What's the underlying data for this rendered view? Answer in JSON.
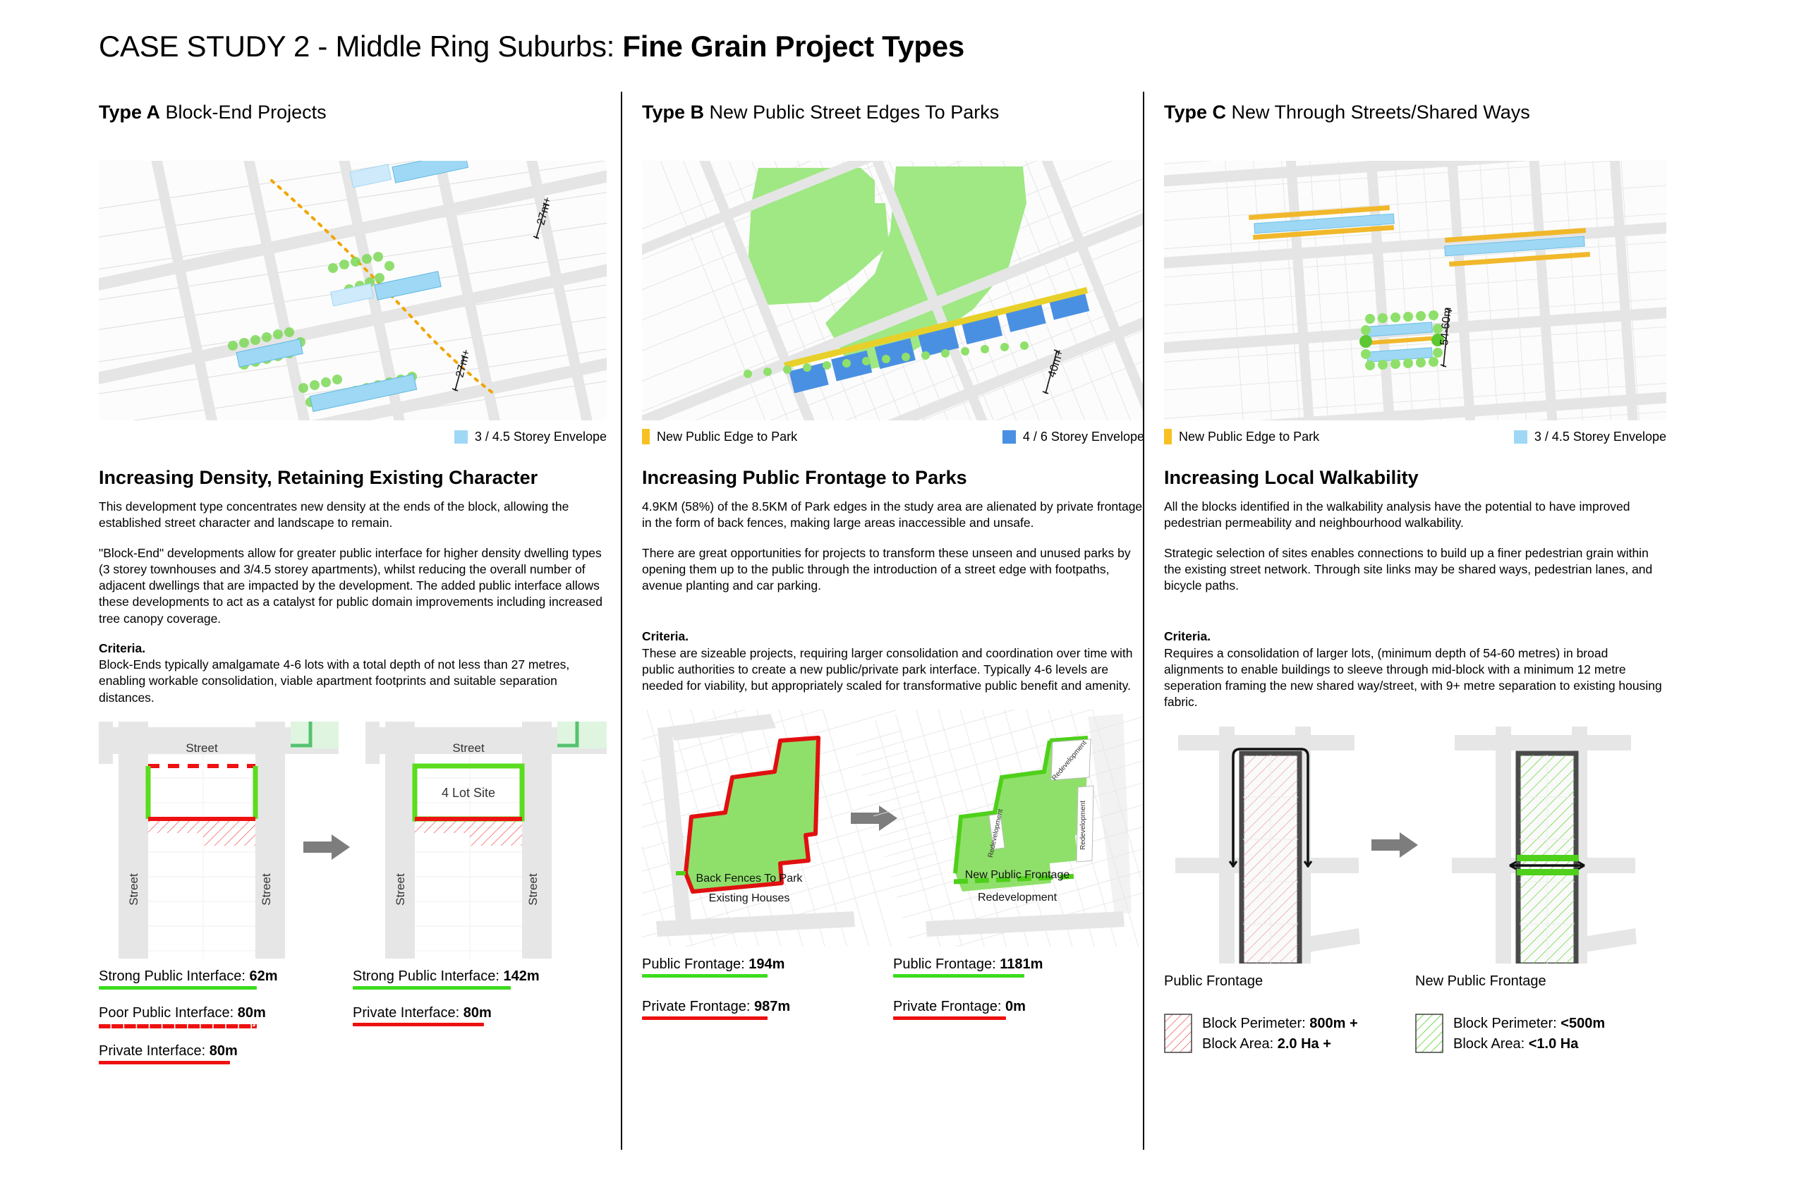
{
  "header": {
    "title_light": "CASE STUDY 2 - Middle Ring Suburbs: ",
    "title_bold": "Fine Grain Project Types"
  },
  "colors": {
    "envelope_light_blue": "#9ed8f5",
    "envelope_blue": "#4a90e2",
    "new_public_edge_yellow": "#f7c122",
    "green_interface": "#3cdc1e",
    "red_interface": "#ee1111",
    "dark_interface": "#4a4a4a",
    "park_green": "#8fe06a",
    "road_grey": "#e3e3e3",
    "arrow_grey": "#7d7d7d"
  },
  "columns": [
    {
      "id": "type-a",
      "label_bold": "Type A",
      "label_rest": " Block-End Projects",
      "map": {
        "annotations": [
          "27m+",
          "27m+"
        ]
      },
      "legend": [
        {
          "name": "storey-envelope",
          "swatch": "#9ed8f5",
          "shape": "square",
          "label": "3 / 4.5 Storey Envelope"
        }
      ],
      "subhead": "Increasing Density, Retaining Existing Character",
      "paragraphs": [
        "This development type concentrates new density at the ends of the block, allowing the established street character and landscape to remain.",
        "\"Block-End\" developments allow for greater public interface for higher density dwelling types (3 storey townhouses and 3/4.5 storey apartments), whilst reducing the overall number of adjacent dwellings that are impacted by the development. The added public interface allows these developments to act as a catalyst for public domain improvements including increased tree canopy coverage."
      ],
      "criteria_label": "Criteria.",
      "criteria_text": "Block-Ends typically amalgamate 4-6 lots with a total depth of not less than 27 metres, enabling workable consolidation, viable apartment footprints and suitable separation distances.",
      "diagram_labels": {
        "street_top_left": "Street",
        "street_left_left": "Street",
        "street_right_left": "Street",
        "street_top_right": "Street",
        "street_left_right": "Street",
        "street_right_right": "Street",
        "lot_site": "4 Lot Site"
      },
      "metrics_left": [
        {
          "label": "Strong Public Interface: ",
          "value": "62m",
          "rule": "green"
        },
        {
          "label": "Poor Public Interface: ",
          "value": "80m",
          "rule": "dashed"
        },
        {
          "label": "Private Interface: ",
          "value": "80m",
          "rule": "red"
        }
      ],
      "metrics_right": [
        {
          "label": "Strong Public Interface: ",
          "value": "142m",
          "rule": "green"
        },
        {
          "label": "Private Interface: ",
          "value": "80m",
          "rule": "red"
        }
      ]
    },
    {
      "id": "type-b",
      "label_bold": "Type B",
      "label_rest": " New Public Street Edges To Parks",
      "map": {
        "annotations": [
          "40m+"
        ]
      },
      "legend": [
        {
          "name": "new-public-edge",
          "swatch": "#f7c122",
          "shape": "bar",
          "label": "New Public Edge to Park"
        },
        {
          "name": "storey-envelope",
          "swatch": "#4a90e2",
          "shape": "square",
          "label": "4 / 6 Storey Envelope"
        }
      ],
      "subhead": "Increasing Public Frontage to Parks",
      "paragraphs": [
        "4.9KM (58%) of the 8.5KM of Park edges in the study area are alienated by private frontage in the form of back fences, making large areas inaccessible and unsafe.",
        "There are great opportunities for projects to transform these unseen and unused parks by opening them up to the public through the introduction of a street edge with footpaths, avenue planting and car parking."
      ],
      "criteria_label": "Criteria.",
      "criteria_text": "These are sizeable projects, requiring larger consolidation and coordination over time with public authorities to create a new public/private park interface. Typically 4-6 levels are needed for viability, but appropriately scaled for transformative public benefit and amenity.",
      "diagram_labels": {
        "back_fences": "Back Fences To Park",
        "existing_houses": "Existing Houses",
        "new_public_frontage": "New Public Frontage",
        "redevelopment": "Redevelopment",
        "redevelopment_side_1": "Redevelopment",
        "redevelopment_side_2": "Redevelopment",
        "redevelopment_side_3": "Redevelopment"
      },
      "metrics_left": [
        {
          "label": "Public Frontage: ",
          "value": "194m",
          "rule": "green"
        },
        {
          "label": "Private Frontage: ",
          "value": "987m",
          "rule": "red"
        }
      ],
      "metrics_right": [
        {
          "label": "Public Frontage: ",
          "value": "1181m",
          "rule": "green"
        },
        {
          "label": "Private Frontage: ",
          "value": "0m",
          "rule": "red"
        }
      ]
    },
    {
      "id": "type-c",
      "label_bold": "Type C",
      "label_rest": " New Through Streets/Shared Ways",
      "map": {
        "annotations": [
          "54-60m"
        ]
      },
      "legend": [
        {
          "name": "new-public-edge",
          "swatch": "#f7c122",
          "shape": "bar",
          "label": "New Public Edge to Park"
        },
        {
          "name": "storey-envelope",
          "swatch": "#9ed8f5",
          "shape": "square",
          "label": "3 / 4.5 Storey Envelope"
        }
      ],
      "subhead": "Increasing Local Walkability",
      "paragraphs": [
        "All the blocks identified in the walkability analysis have the potential to have improved pedestrian permeability and neighbourhood walkability.",
        "Strategic selection of sites enables connections to build up a finer pedestrian grain within the  existing street network. Through site links may be shared ways, pedestrian lanes, and bicycle paths."
      ],
      "criteria_label": "Criteria.",
      "criteria_text": "Requires a consolidation of larger lots, (minimum depth of  54-60 metres) in broad alignments to enable buildings to sleeve through mid-block with a minimum 12 metre seperation framing the new shared way/street, with 9+ metre separation to existing housing fabric.",
      "frontage_left_head": "Public Frontage",
      "frontage_right_head": "New Public Frontage",
      "block_legend_left": {
        "perimeter_label": "Block Perimeter: ",
        "perimeter_value": "800m +",
        "area_label": "Block Area: ",
        "area_value": "2.0 Ha +"
      },
      "block_legend_right": {
        "perimeter_label": "Block Perimeter: ",
        "perimeter_value": "<500m",
        "area_label": "Block Area: ",
        "area_value": "<1.0 Ha"
      }
    }
  ]
}
